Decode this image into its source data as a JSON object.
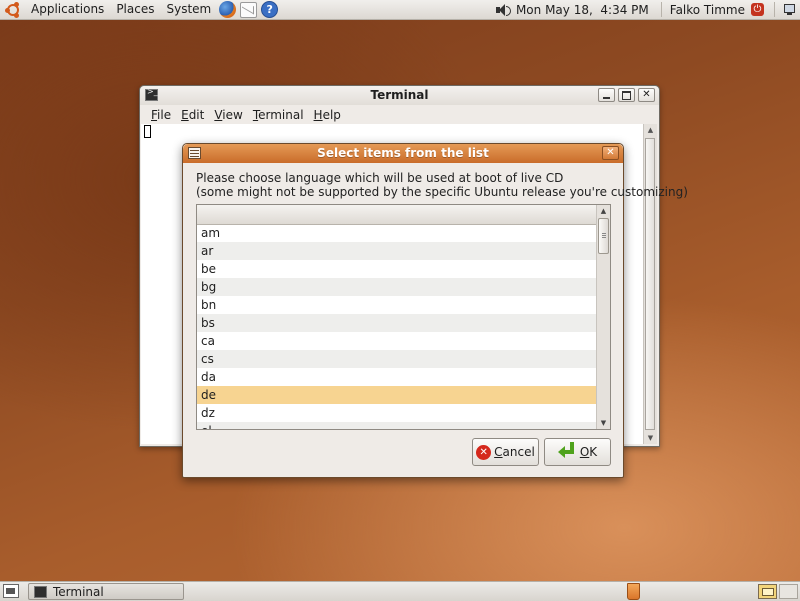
{
  "top_panel": {
    "menus": [
      "Applications",
      "Places",
      "System"
    ],
    "clock": "Mon May 18,  4:34 PM",
    "user": "Falko Timme",
    "icons": [
      "ubuntu-logo-icon",
      "firefox-icon",
      "mail-icon",
      "help-icon",
      "volume-icon",
      "power-icon",
      "network-icon"
    ]
  },
  "terminal": {
    "title": "Terminal",
    "menu": [
      {
        "label": "File",
        "mnemonic": "F",
        "rest": "ile"
      },
      {
        "label": "Edit",
        "mnemonic": "E",
        "rest": "dit"
      },
      {
        "label": "View",
        "mnemonic": "V",
        "rest": "iew"
      },
      {
        "label": "Terminal",
        "mnemonic": "T",
        "rest": "erminal"
      },
      {
        "label": "Help",
        "mnemonic": "H",
        "rest": "elp"
      }
    ]
  },
  "dialog": {
    "title": "Select items from the list",
    "prompt_line1": "Please choose language which will be used at boot of live CD",
    "prompt_line2": "(some might not be supported by the specific Ubuntu release you're customizing)",
    "items": [
      "am",
      "ar",
      "be",
      "bg",
      "bn",
      "bs",
      "ca",
      "cs",
      "da",
      "de",
      "dz",
      "el"
    ],
    "selected": "de",
    "cancel": {
      "mnemonic": "C",
      "rest": "ancel"
    },
    "ok": {
      "mnemonic": "O",
      "rest": "K"
    }
  },
  "bottom_panel": {
    "task_label": "Terminal"
  },
  "colors": {
    "dialog_title_bar": "#d57c38",
    "selected_row": "#f7d491",
    "cancel_icon": "#d5281c",
    "ok_icon": "#4fa21c"
  }
}
